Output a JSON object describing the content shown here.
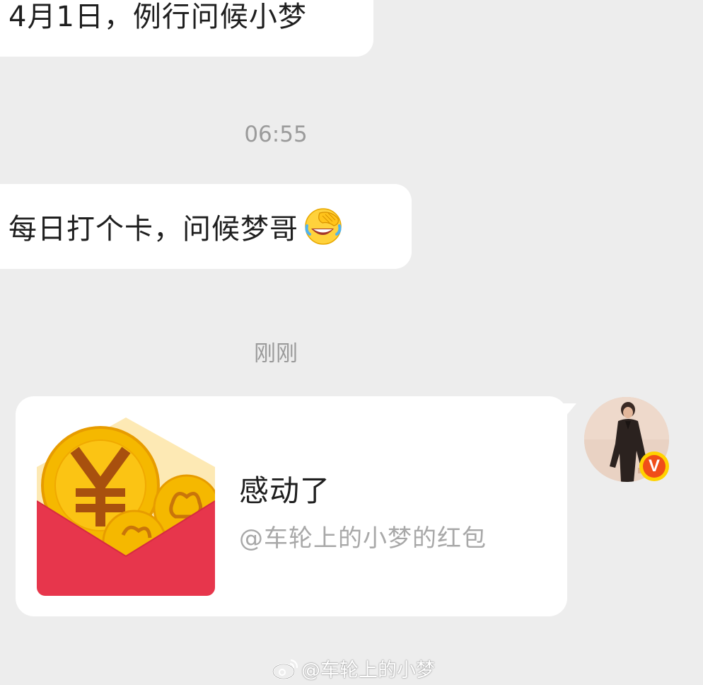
{
  "messages": [
    {
      "text": "4月1日，例行问候小梦",
      "emoji": ""
    },
    {
      "text": "每日打个卡，问候梦哥",
      "emoji": "laugh-cry-facepalm-icon"
    }
  ],
  "timestamps": [
    "06:55",
    "刚刚"
  ],
  "red_packet": {
    "title": "感动了",
    "subtitle": "@车轮上的小梦的红包",
    "accent_color": "#e7364c",
    "coin_color": "#f5b800"
  },
  "avatar": {
    "verified_badge": "V",
    "badge_color": "#f04e19"
  },
  "watermark": {
    "text": "@车轮上的小梦",
    "icon": "weibo-logo-icon"
  }
}
